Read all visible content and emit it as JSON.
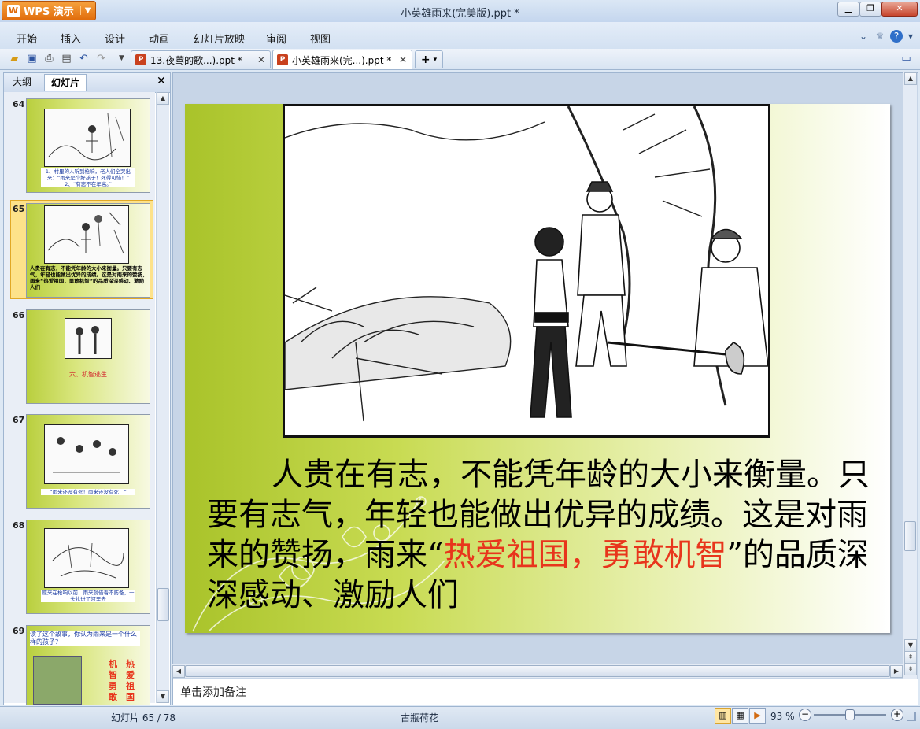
{
  "app": {
    "brand": "WPS 演示",
    "window_title": "小英雄雨来(完美版).ppt *"
  },
  "menu": {
    "items": [
      "开始",
      "插入",
      "设计",
      "动画",
      "幻灯片放映",
      "审阅",
      "视图"
    ]
  },
  "tabs": [
    {
      "label": "13.夜莺的歌...).ppt *",
      "active": false
    },
    {
      "label": "小英雄雨来(完...).ppt *",
      "active": true
    }
  ],
  "panel": {
    "tab_outline": "大纲",
    "tab_slides": "幻灯片",
    "thumbnails": [
      {
        "number": "64",
        "caption": "1、村里的人听到枪响，老人们全哭出来：“雨来是个好孩子！死得可惜！”  2、“有志不在年高。”"
      },
      {
        "number": "65",
        "caption": "人贵在有志，不能凭年龄的大小来衡量。只要有志气，年轻也能做出优异的成绩。这是对雨来的赞扬，雨来“热爱祖国，勇敢机智”的品质深深感动、激励人们",
        "selected": true
      },
      {
        "number": "66",
        "caption": "六、机智逃生"
      },
      {
        "number": "67",
        "caption": "“雨来还没有死！雨来还没有死！”"
      },
      {
        "number": "68",
        "caption": "原来在枪响以前，雨来就借着不防备，一头扎进了河里去"
      },
      {
        "number": "69",
        "caption": "读了这个故事，你认为雨来是一个什么样的孩子？",
        "words_left": "机智勇敢",
        "words_right": "热爱祖国"
      }
    ]
  },
  "slide": {
    "text_before": "人贵在有志，不能凭年龄的大小来衡量。只要有志气，年轻也能做出优异的成绩。这是对雨来的赞扬，雨来“",
    "text_highlight": "热爱祖国，勇敢机智",
    "text_after": "”的品质深深感动、激励人们",
    "highlight_color": "#e8351c"
  },
  "notes": {
    "placeholder": "单击添加备注"
  },
  "status": {
    "slide_counter": "幻灯片 65 / 78",
    "theme": "古瓶荷花",
    "zoom": "93 %",
    "zoom_level": 0.5
  }
}
